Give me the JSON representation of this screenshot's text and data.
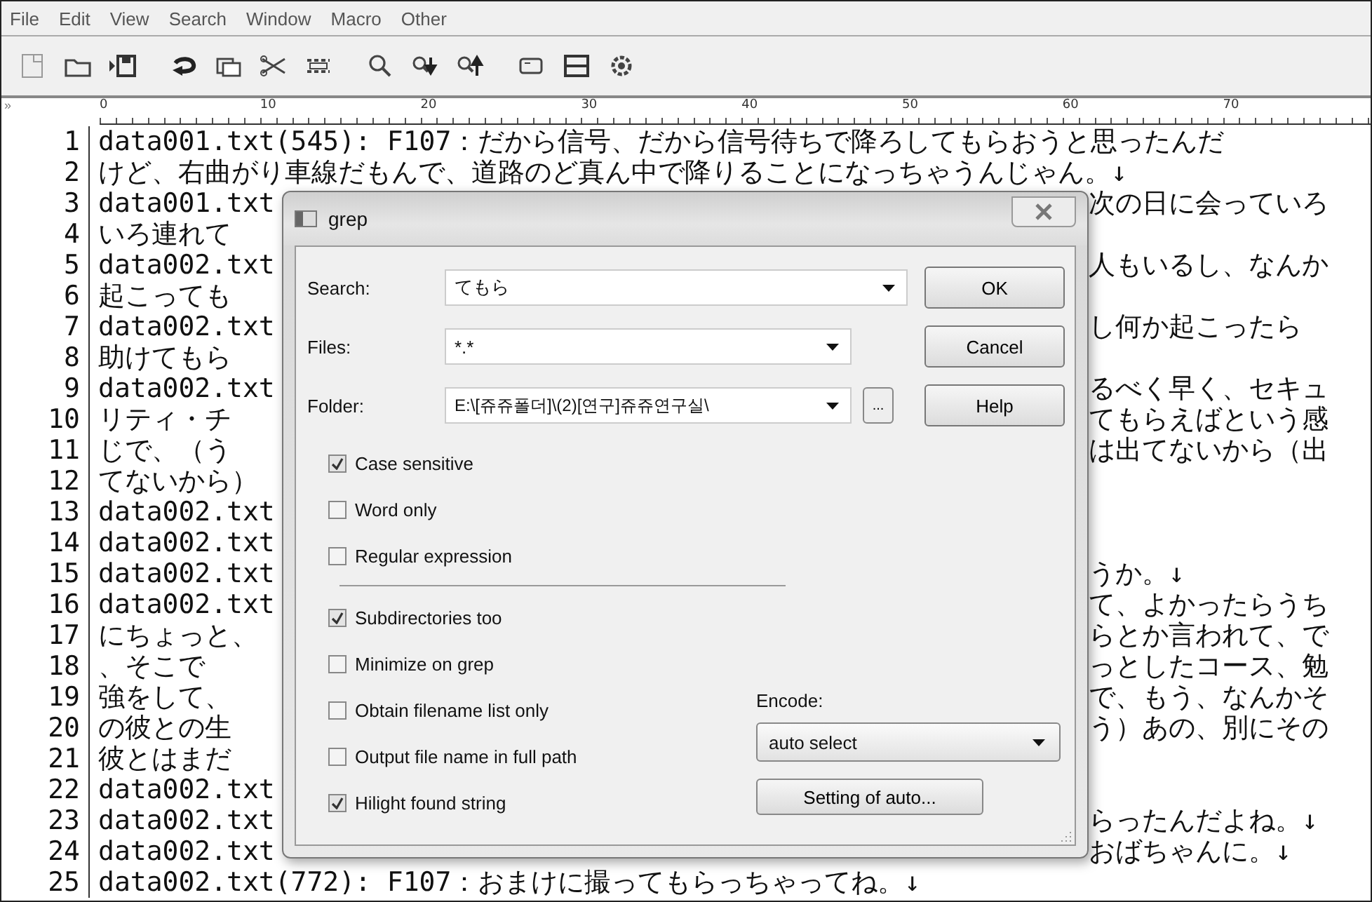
{
  "menu": [
    "File",
    "Edit",
    "View",
    "Search",
    "Window",
    "Macro",
    "Other"
  ],
  "ruler": {
    "marker": "»",
    "labels": [
      "0",
      "10",
      "20",
      "30",
      "40",
      "50",
      "60",
      "70"
    ]
  },
  "lines": [
    {
      "number": "1",
      "text": "data001.txt(545): F107：だから信号、だから信号待ちで降ろしてもらおうと思ったんだ"
    },
    {
      "number": "2",
      "text": "けど、右曲がり車線だもんで、道路のど真ん中で降りることになっちゃうんじゃん。↓"
    },
    {
      "number": "3",
      "left": "data001.txt",
      "right": "次の日に会っていろ"
    },
    {
      "number": "4",
      "left": "いろ連れて"
    },
    {
      "number": "5",
      "left": "data002.txt",
      "right": "人もいるし、なんか"
    },
    {
      "number": "6",
      "left": "起こっても"
    },
    {
      "number": "7",
      "left": "data002.txt",
      "right": "し何か起こったら"
    },
    {
      "number": "8",
      "left": "助けてもら"
    },
    {
      "number": "9",
      "left": "data002.txt",
      "right": "るべく早く、セキュ"
    },
    {
      "number": "10",
      "left": "リティ・チ",
      "right": "てもらえばという感"
    },
    {
      "number": "11",
      "left": "じで、（う",
      "right": "は出てないから（出"
    },
    {
      "number": "12",
      "left": "てないから）"
    },
    {
      "number": "13",
      "left": "data002.txt"
    },
    {
      "number": "14",
      "left": "data002.txt"
    },
    {
      "number": "15",
      "left": "data002.txt",
      "right": "うか。↓"
    },
    {
      "number": "16",
      "left": "data002.txt",
      "right": "て、よかったらうち"
    },
    {
      "number": "17",
      "left": "にちょっと、",
      "right": "らとか言われて、で"
    },
    {
      "number": "18",
      "left": "、そこで",
      "right": "っとしたコース、勉"
    },
    {
      "number": "19",
      "left": "強をして、",
      "right": "で、もう、なんかそ"
    },
    {
      "number": "20",
      "left": "の彼との生",
      "right": "う）あの、別にその"
    },
    {
      "number": "21",
      "left": "彼とはまだ"
    },
    {
      "number": "22",
      "left": "data002.txt"
    },
    {
      "number": "23",
      "left": "data002.txt",
      "right": "らったんだよね。↓"
    },
    {
      "number": "24",
      "left": "data002.txt",
      "right": "おばちゃんに。↓"
    },
    {
      "number": "25",
      "text": "data002.txt(772): F107：おまけに撮ってもらっちゃってね。↓"
    }
  ],
  "dialog": {
    "title": "grep",
    "fields": [
      {
        "label": "Search:",
        "value": "てもら",
        "dropdown": true
      },
      {
        "label": "Files:",
        "value": "*.*",
        "dropdown": true
      },
      {
        "label": "Folder:",
        "value": "E:\\[쥬쥬폴더]\\(2)[연구]쥬쥬연구실\\",
        "dropdown": true,
        "browse": "..."
      }
    ],
    "buttons": [
      "OK",
      "Cancel",
      "Help"
    ],
    "options": [
      {
        "label": "Case sensitive",
        "checked": true
      },
      {
        "label": "Word only",
        "checked": false
      },
      {
        "label": "Regular expression",
        "checked": false
      }
    ],
    "more_options": [
      {
        "label": "Subdirectories too",
        "checked": true
      },
      {
        "label": "Minimize on grep",
        "checked": false
      },
      {
        "label": "Obtain filename list only",
        "checked": false
      },
      {
        "label": "Output file name in full path",
        "checked": false
      },
      {
        "label": "Hilight found string",
        "checked": true
      }
    ],
    "encode": {
      "label": "Encode:",
      "value": "auto select",
      "button": "Setting of auto..."
    }
  }
}
